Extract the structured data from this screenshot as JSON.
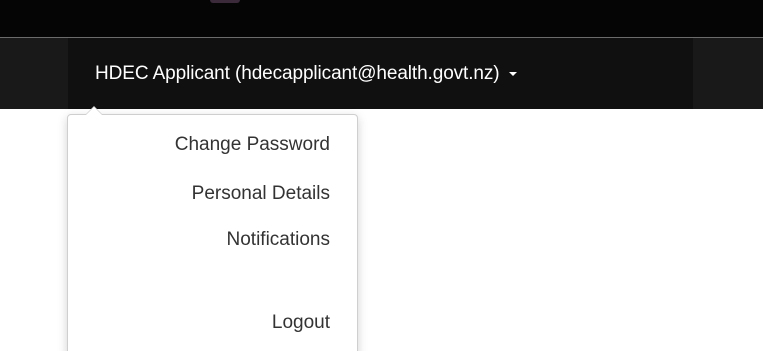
{
  "navbar": {
    "user_label": "HDEC Applicant (hdecapplicant@health.govt.nz)",
    "caret_icon": "caret-down-icon"
  },
  "dropdown": {
    "items": [
      {
        "label": "Change Password"
      },
      {
        "label": "Personal Details"
      },
      {
        "label": "Notifications"
      },
      {
        "label": "Logout"
      }
    ]
  },
  "colors": {
    "top_strip": "#050505",
    "navbar": "#191919",
    "nav_user_bg": "#101010",
    "nav_text": "#ffffff",
    "menu_text": "#333333"
  }
}
